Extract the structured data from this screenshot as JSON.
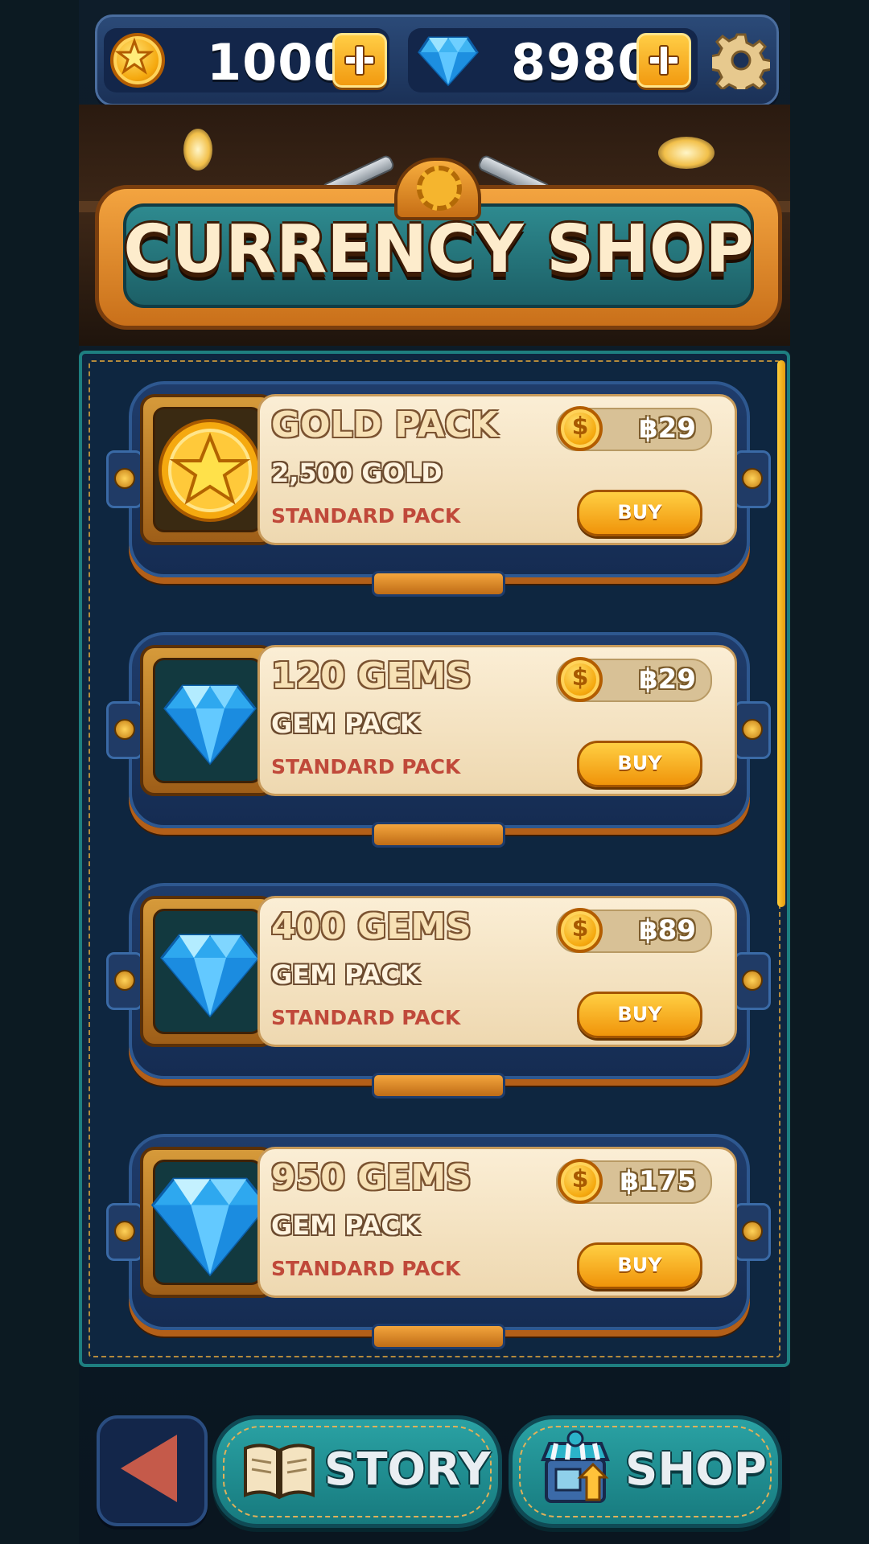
{
  "header": {
    "gold_amount": "1000",
    "gem_amount": "8980",
    "icons": {
      "gold": "gold-coin-icon",
      "gem": "diamond-icon",
      "settings": "gear-icon"
    }
  },
  "banner": {
    "title": "CURRENCY SHOP"
  },
  "items": [
    {
      "title": "GOLD PACK",
      "subtitle": "2,500 GOLD",
      "tag": "STANDARD PACK",
      "price": "฿29",
      "buy_label": "BUY",
      "icon": "gold-star-coin-icon"
    },
    {
      "title": "120 GEMS",
      "subtitle": "GEM PACK",
      "tag": "STANDARD PACK",
      "price": "฿29",
      "buy_label": "BUY",
      "icon": "gem-icon"
    },
    {
      "title": "400 GEMS",
      "subtitle": "GEM PACK",
      "tag": "STANDARD PACK",
      "price": "฿89",
      "buy_label": "BUY",
      "icon": "gem-icon"
    },
    {
      "title": "950 GEMS",
      "subtitle": "GEM PACK",
      "tag": "STANDARD PACK",
      "price": "฿175",
      "buy_label": "BUY",
      "icon": "large-gem-icon"
    }
  ],
  "price_coin_symbol": "$",
  "nav": {
    "story_label": "STORY",
    "shop_label": "SHOP"
  },
  "colors": {
    "accent": "#f2a31a",
    "panel": "#0e2640",
    "teal": "#1e8a8d",
    "tag_red": "#c0493a"
  }
}
